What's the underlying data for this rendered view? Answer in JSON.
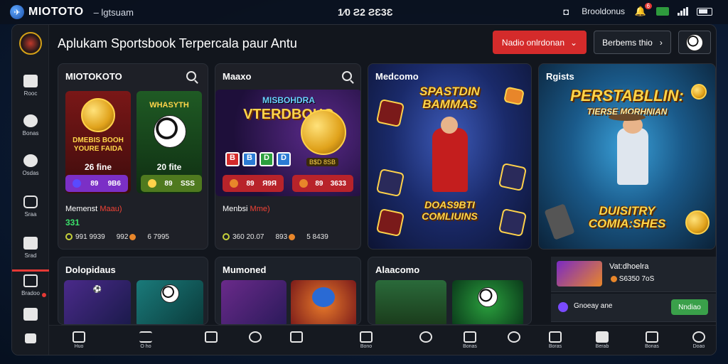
{
  "topbar": {
    "brand": "MIOTOTO",
    "tagline": "– lgtsuam",
    "center": "1⁄0 Ƨ2 ƧƐ3Ɛ",
    "status_label": "Brooldonus",
    "notif_count": "6"
  },
  "header": {
    "title": "Aplukam Sportsbook  Terpercala paur Antu",
    "primary_button": "Nadio onlrdonan",
    "secondary_button": "Berbems thio"
  },
  "sidebar": {
    "items": [
      {
        "label": "Rooc",
        "icon": "bookmark-icon"
      },
      {
        "label": "Bonas",
        "icon": "chat-icon"
      },
      {
        "label": "Osdas",
        "icon": "check-icon"
      },
      {
        "label": "Sraa",
        "icon": "shield-icon"
      },
      {
        "label": "Srad",
        "icon": "monitor-icon"
      },
      {
        "label": "Bradoo",
        "icon": "home-icon"
      },
      {
        "label": "",
        "icon": "store-icon"
      },
      {
        "label": "",
        "icon": "house-icon"
      }
    ]
  },
  "cards": [
    {
      "title": "MIOTOKOTO",
      "tile1_text": "DMEBIS BOOH\nYOURE FAIDA",
      "tile1_value": "26 fine",
      "tile2_text": "WHASYTH",
      "tile2_value": "20 fite",
      "pill1": [
        "89",
        "9B6"
      ],
      "pill2": [
        "89",
        "SSS"
      ],
      "meta_title": "Memenst",
      "meta_highlight": "Maau)",
      "meta_num": "331",
      "meta_a": "991 9939",
      "meta_b": "992",
      "meta_c": "6 7995"
    },
    {
      "title": "Maaxo",
      "banner": "VTERDBOHO",
      "banner_top": "MISBOHDRA",
      "chips": [
        "B",
        "B",
        "D",
        "D"
      ],
      "tile_label": "B$D 8SB",
      "pill1": [
        "89",
        "Я9Я"
      ],
      "pill2": [
        "89",
        "3633"
      ],
      "meta_title": "Menbsi",
      "meta_highlight": "Mme)",
      "meta_a": "360 20.07",
      "meta_b": "893",
      "meta_c": "5 8439"
    },
    {
      "title": "Medcomo",
      "banner_top": "SPASTDIN BAMMAS",
      "banner_bottom": "DOAS9BTI COMLIUINS"
    },
    {
      "title": "Rgists",
      "banner_top": "PERSTABLLIN:",
      "banner_sub": "TIERSE MORHNIAN",
      "banner_bottom": "DUISITRY COMIA:SHES"
    },
    {
      "title": "Dolopidaus"
    },
    {
      "title": "Mumoned"
    },
    {
      "title": "Alaacomo"
    }
  ],
  "side_panel": {
    "item1_title": "Vat:dhoelra",
    "item1_sub": "S6350 7oS",
    "item2_title": "Gnoeay ane",
    "item2_button": "Nndiao"
  },
  "bottom_nav": {
    "items": [
      {
        "label": "Huo",
        "icon": "home-icon"
      },
      {
        "label": "O ho",
        "icon": "menu-icon"
      },
      {
        "label": "",
        "icon": "house-icon"
      },
      {
        "label": "",
        "icon": "search-icon"
      },
      {
        "label": "",
        "icon": "crop-icon"
      },
      {
        "label": "Bono",
        "icon": "box-icon"
      },
      {
        "label": "",
        "icon": "chat-icon"
      },
      {
        "label": "Bonas",
        "icon": "ticket-icon"
      },
      {
        "label": "",
        "icon": "check-icon"
      },
      {
        "label": "Boras",
        "icon": "store-icon"
      },
      {
        "label": "Berab",
        "icon": "video-icon"
      },
      {
        "label": "Bonas",
        "icon": "house-icon"
      },
      {
        "label": "Doao",
        "icon": "clock-icon"
      }
    ]
  },
  "colors": {
    "accent_red": "#d42b2b",
    "accent_green": "#3be06a",
    "gold": "#ffd54a"
  }
}
